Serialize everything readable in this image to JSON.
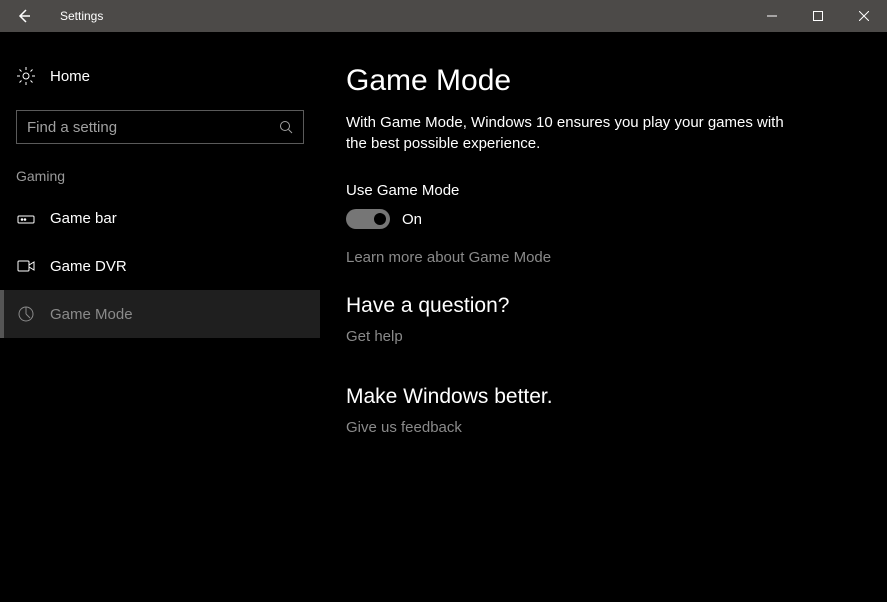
{
  "titlebar": {
    "app_title": "Settings"
  },
  "sidebar": {
    "home_label": "Home",
    "search_placeholder": "Find a setting",
    "section_label": "Gaming",
    "items": [
      {
        "label": "Game bar"
      },
      {
        "label": "Game DVR"
      },
      {
        "label": "Game Mode"
      }
    ]
  },
  "content": {
    "title": "Game Mode",
    "lead": "With Game Mode, Windows 10 ensures you play your games with the best possible experience.",
    "toggle_label": "Use Game Mode",
    "toggle_state": "On",
    "learn_more": "Learn more about Game Mode",
    "question_heading": "Have a question?",
    "get_help": "Get help",
    "improve_heading": "Make Windows better.",
    "feedback": "Give us feedback"
  }
}
